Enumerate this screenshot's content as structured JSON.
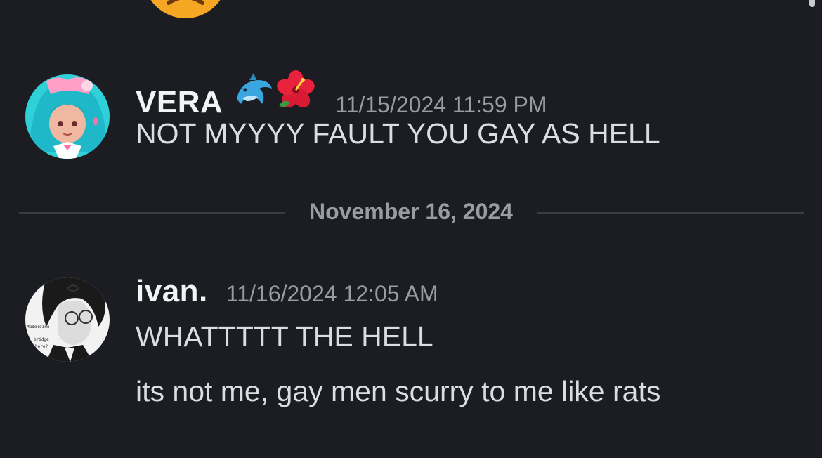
{
  "partial_emoji": {
    "icon": "angry-face-emoji-icon",
    "color": "#f5a623"
  },
  "messages": [
    {
      "username": "VERA",
      "username_icons": [
        "dolphin-emoji-icon",
        "hibiscus-emoji-icon"
      ],
      "timestamp": "11/15/2024 11:59 PM",
      "lines": [
        "NOT MYYYY FAULT YOU GAY AS HELL"
      ],
      "avatar_colors": {
        "bg": "#2fd0d8",
        "hair": "#1fb8c8",
        "skin": "#f0b8a0",
        "accent": "#ff6fa8"
      }
    },
    {
      "username": "ivan.",
      "timestamp": "11/16/2024 12:05 AM",
      "lines": [
        "WHATTTTT THE HELL",
        "its not me, gay men scurry to me like rats"
      ],
      "avatar_text": [
        "Madeleine",
        "bridge",
        "here?"
      ]
    }
  ],
  "date_divider": {
    "label": "November 16, 2024"
  },
  "colors": {
    "background": "#1c1d22",
    "text": "#dbdde1",
    "muted": "#9a9ca3",
    "divider": "#3a3c42"
  }
}
